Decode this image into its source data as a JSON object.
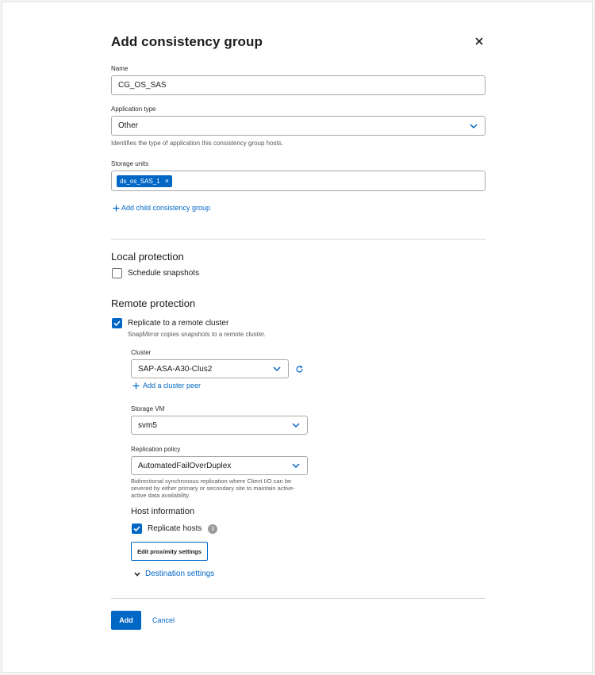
{
  "dialog": {
    "title": "Add consistency group"
  },
  "name": {
    "label": "Name",
    "value": "CG_OS_SAS"
  },
  "application_type": {
    "label": "Application type",
    "value": "Other",
    "help": "Identifies the type of application this consistency group hosts."
  },
  "storage_units": {
    "label": "Storage units",
    "chips": [
      "ds_os_SAS_1"
    ]
  },
  "add_child_link": "Add child consistency group",
  "local_protection": {
    "heading": "Local protection",
    "schedule_snapshots": {
      "label": "Schedule snapshots",
      "checked": false
    }
  },
  "remote_protection": {
    "heading": "Remote protection",
    "replicate": {
      "label": "Replicate to a remote cluster",
      "checked": true,
      "help": "SnapMirror copies snapshots to a remote cluster."
    },
    "cluster": {
      "label": "Cluster",
      "value": "SAP-ASA-A30-Clus2",
      "add_peer_link": "Add a cluster peer"
    },
    "storage_vm": {
      "label": "Storage VM",
      "value": "svm5"
    },
    "replication_policy": {
      "label": "Replication policy",
      "value": "AutomatedFailOverDuplex",
      "help_line1": "Bidirectional synchronous replication where Client I/O can be",
      "help_line2": "severed by either primary or secondary site to maintain active-",
      "help_line3": "active data availability."
    },
    "host_information": {
      "heading": "Host information",
      "replicate_hosts": {
        "label": "Replicate hosts",
        "checked": true
      },
      "edit_proximity_button": "Edit proximity settings"
    },
    "destination_settings": "Destination settings"
  },
  "footer": {
    "add_label": "Add",
    "cancel_label": "Cancel"
  },
  "colors": {
    "accent": "#0067c5",
    "border": "#a9a9a9",
    "divider": "#d8d8d8"
  }
}
